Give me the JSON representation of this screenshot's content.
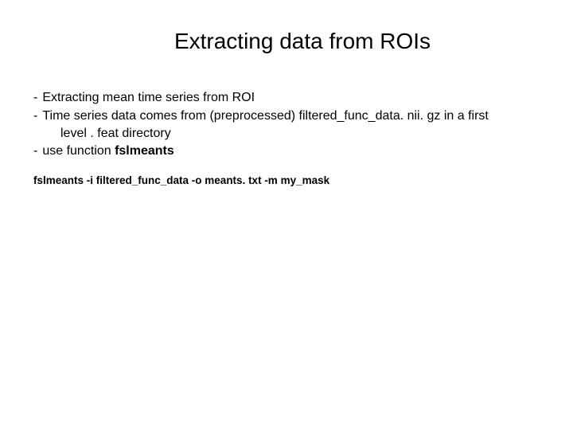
{
  "title": "Extracting data from ROIs",
  "bullets": {
    "b1": "Extracting mean time series from ROI",
    "b2a": "Time series data comes from (preprocessed) filtered_func_data. nii. gz in a first",
    "b2b": "level . feat directory",
    "b3_prefix": "use function ",
    "b3_bold": "fslmeants"
  },
  "command": "fslmeants -i filtered_func_data -o meants. txt -m my_mask"
}
